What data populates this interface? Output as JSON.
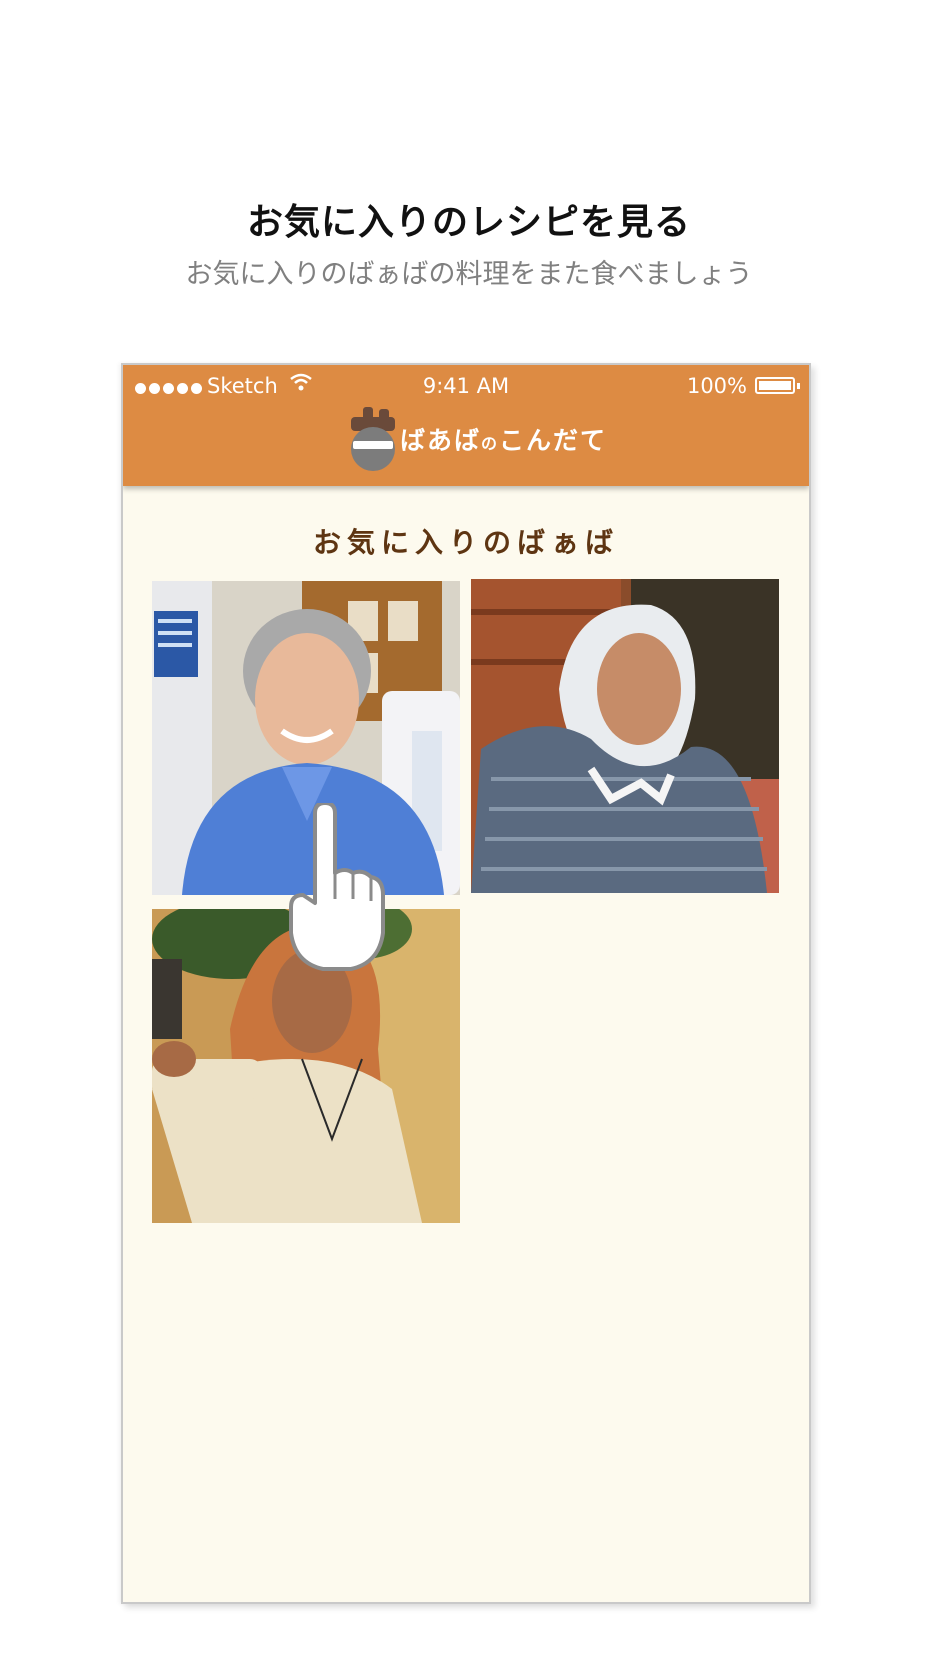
{
  "promo": {
    "title": "お気に入りのレシピを見る",
    "subtitle": "お気に入りのばぁばの料理をまた食べましょう"
  },
  "status_bar": {
    "carrier": "Sketch",
    "time": "9:41 AM",
    "battery": "100%"
  },
  "app": {
    "logo_text_1": "ばあば",
    "logo_text_2": "の",
    "logo_text_3": "こんだて",
    "header_color": "#dd8b43"
  },
  "favorites": {
    "heading": "お気に入りのばぁば",
    "items": [
      {
        "name": "grandma-blue-cardigan"
      },
      {
        "name": "grandma-white-headscarf"
      },
      {
        "name": "grandma-orange-scarf"
      }
    ]
  }
}
